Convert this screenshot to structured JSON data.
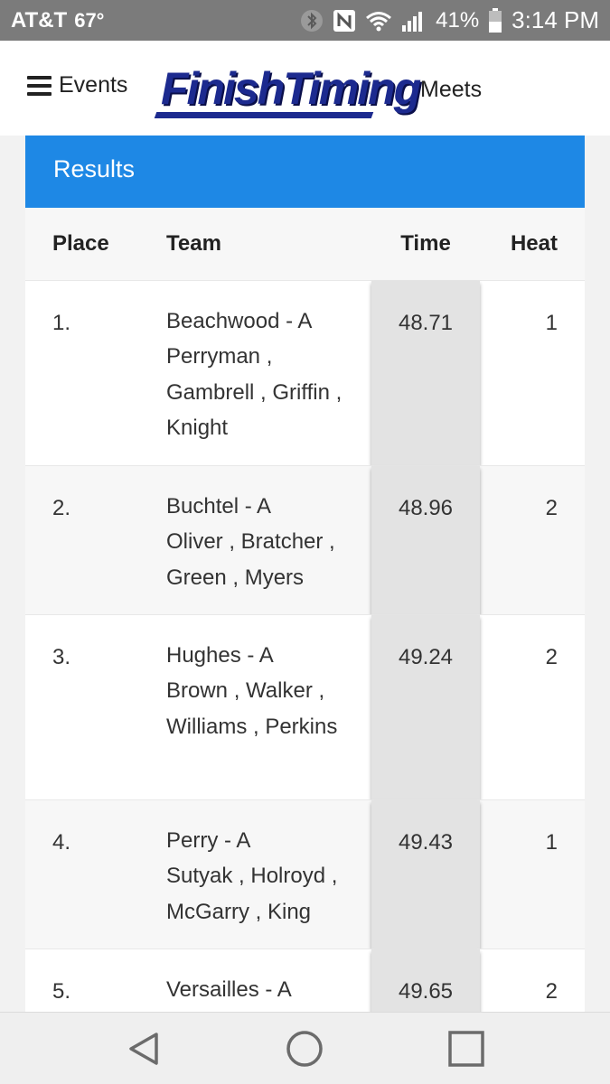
{
  "status_bar": {
    "carrier": "AT&T",
    "temperature": "67°",
    "battery_percent": "41%",
    "time": "3:14 PM",
    "icons": [
      "bluetooth-icon",
      "nfc-icon",
      "wifi-icon",
      "signal-icon",
      "battery-icon"
    ]
  },
  "header": {
    "menu_label": "Events",
    "logo_text": "FinishTiming",
    "meets_label": "Meets"
  },
  "results": {
    "title": "Results",
    "columns": {
      "place": "Place",
      "team": "Team",
      "time": "Time",
      "heat": "Heat"
    },
    "rows": [
      {
        "place": "1.",
        "team": "Beachwood - A",
        "athletes": "Perryman , Gambrell , Griffin , Knight",
        "time": "48.71",
        "heat": "1"
      },
      {
        "place": "2.",
        "team": "Buchtel - A",
        "athletes": "Oliver , Bratcher , Green , Myers",
        "time": "48.96",
        "heat": "2"
      },
      {
        "place": "3.",
        "team": "Hughes - A",
        "athletes": "Brown , Walker , Williams , Perkins",
        "time": "49.24",
        "heat": "2"
      },
      {
        "place": "4.",
        "team": "Perry - A",
        "athletes": "Sutyak , Holroyd , McGarry , King",
        "time": "49.43",
        "heat": "1"
      },
      {
        "place": "5.",
        "team": "Versailles - A",
        "athletes": "",
        "time": "49.65",
        "heat": "2"
      }
    ]
  },
  "nav_bar": {
    "icons": [
      "back-icon",
      "home-icon",
      "recents-icon"
    ]
  },
  "colors": {
    "status_bar": "#7b7b7b",
    "results_header": "#1e88e5",
    "logo": "#1c2a8f"
  }
}
